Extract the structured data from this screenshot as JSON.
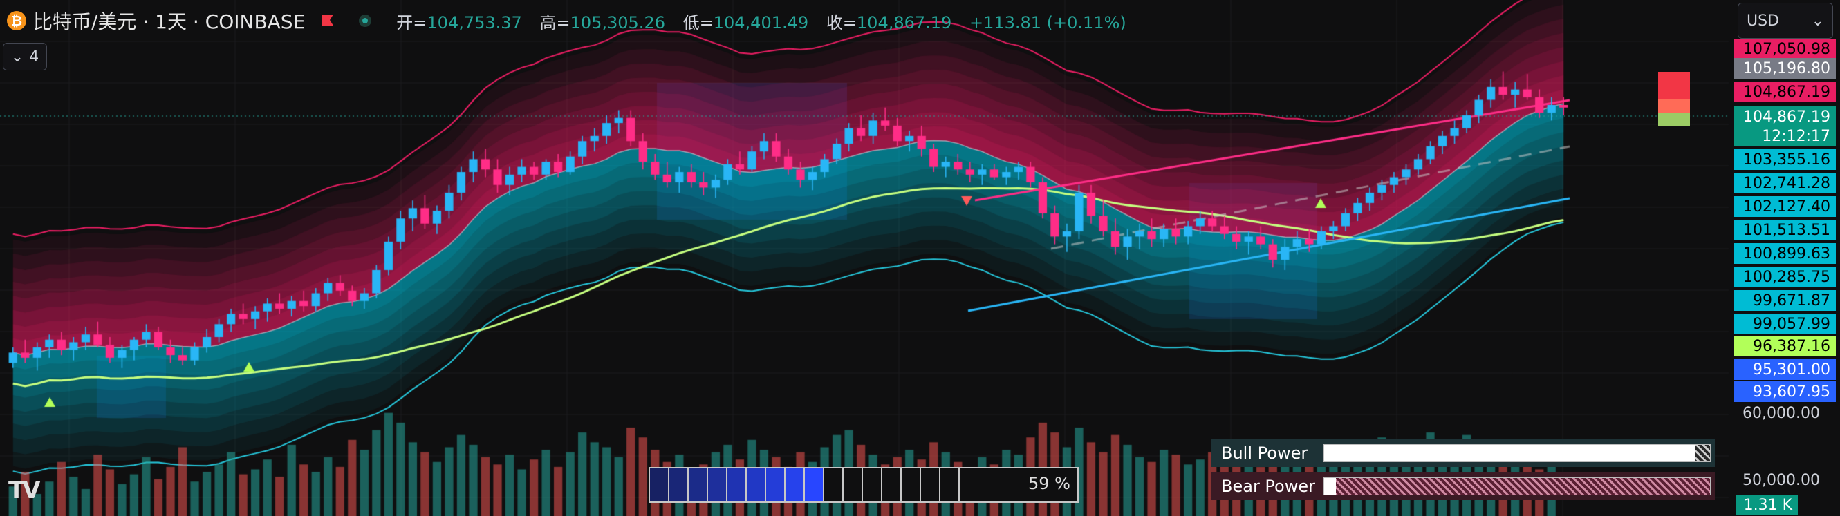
{
  "header": {
    "coin_icon": "bitcoin-icon",
    "symbol": "比特币/美元 · 1天 · COINBASE",
    "open_label": "开=",
    "open_value": "104,753.37",
    "high_label": "高=",
    "high_value": "105,305.26",
    "low_label": "低=",
    "low_value": "104,401.49",
    "close_label": "收=",
    "close_value": "104,867.19",
    "change": "+113.81 (+0.11%)"
  },
  "toolbar": {
    "collapse_label": "4",
    "currency": "USD"
  },
  "price_axis": {
    "labels": [
      {
        "text": "107,050.98",
        "bg": "#e91e63",
        "color": "#000000"
      },
      {
        "text": "105,196.80",
        "bg": "#787b86",
        "color": "#ffffff"
      },
      {
        "text": "104,867.19",
        "bg": "#e91e63",
        "color": "#000000"
      },
      {
        "text": "104,867.19",
        "bg": "#089981",
        "color": "#ffffff"
      },
      {
        "text": "12:12:17",
        "bg": "#089981",
        "color": "#ffffff"
      },
      {
        "text": "103,355.16",
        "bg": "#00bcd4",
        "color": "#000000"
      },
      {
        "text": "102,741.28",
        "bg": "#00bcd4",
        "color": "#000000"
      },
      {
        "text": "102,127.40",
        "bg": "#00bcd4",
        "color": "#000000"
      },
      {
        "text": "101,513.51",
        "bg": "#00bcd4",
        "color": "#000000"
      },
      {
        "text": "100,899.63",
        "bg": "#00bcd4",
        "color": "#000000"
      },
      {
        "text": "100,285.75",
        "bg": "#00bcd4",
        "color": "#000000"
      },
      {
        "text": "99,671.87",
        "bg": "#00bcd4",
        "color": "#000000"
      },
      {
        "text": "99,057.99",
        "bg": "#00bcd4",
        "color": "#000000"
      },
      {
        "text": "96,387.16",
        "bg": "#b2ff59",
        "color": "#000000"
      },
      {
        "text": "95,301.00",
        "bg": "#2962ff",
        "color": "#ffffff"
      },
      {
        "text": "93,607.95",
        "bg": "#2962ff",
        "color": "#ffffff"
      }
    ],
    "volume_labels": [
      "60,000.00",
      "50,000.00"
    ],
    "volume_current": "1.31 K"
  },
  "gauge": {
    "percent_text": "59 %",
    "filled_cells": 9,
    "total_cells": 16
  },
  "power": {
    "bull_label": "Bull Power",
    "bull_fraction": 0.96,
    "bear_label": "Bear Power",
    "bear_fraction": 0.03
  },
  "logo": "TV",
  "chart_data": {
    "type": "candlestick",
    "candles": [
      [
        95.0,
        95.6,
        94.8,
        95.4
      ],
      [
        95.4,
        95.9,
        95.0,
        95.2
      ],
      [
        95.2,
        95.8,
        94.7,
        95.6
      ],
      [
        95.6,
        96.1,
        95.2,
        95.9
      ],
      [
        95.9,
        96.2,
        95.3,
        95.5
      ],
      [
        95.5,
        96.0,
        95.1,
        95.8
      ],
      [
        95.8,
        96.4,
        95.5,
        96.1
      ],
      [
        96.1,
        96.6,
        95.6,
        95.7
      ],
      [
        95.7,
        96.0,
        95.0,
        95.2
      ],
      [
        95.2,
        95.7,
        94.8,
        95.5
      ],
      [
        95.5,
        96.0,
        95.1,
        95.9
      ],
      [
        95.9,
        96.5,
        95.6,
        96.2
      ],
      [
        96.2,
        96.4,
        95.5,
        95.6
      ],
      [
        95.6,
        95.9,
        95.0,
        95.3
      ],
      [
        95.3,
        95.6,
        94.9,
        95.1
      ],
      [
        95.1,
        95.8,
        94.9,
        95.6
      ],
      [
        95.6,
        96.3,
        95.4,
        96.0
      ],
      [
        96.0,
        96.7,
        95.8,
        96.5
      ],
      [
        96.5,
        97.1,
        96.2,
        96.9
      ],
      [
        96.9,
        97.3,
        96.5,
        96.7
      ],
      [
        96.7,
        97.2,
        96.3,
        97.0
      ],
      [
        97.0,
        97.5,
        96.6,
        97.3
      ],
      [
        97.3,
        97.7,
        96.9,
        97.1
      ],
      [
        97.1,
        97.6,
        96.8,
        97.4
      ],
      [
        97.4,
        97.8,
        97.0,
        97.2
      ],
      [
        97.2,
        97.9,
        97.0,
        97.7
      ],
      [
        97.7,
        98.3,
        97.4,
        98.1
      ],
      [
        98.1,
        98.4,
        97.6,
        97.8
      ],
      [
        97.8,
        98.0,
        97.2,
        97.4
      ],
      [
        97.4,
        97.9,
        97.1,
        97.7
      ],
      [
        97.7,
        98.8,
        97.5,
        98.6
      ],
      [
        98.6,
        99.9,
        98.4,
        99.7
      ],
      [
        99.7,
        100.9,
        99.4,
        100.6
      ],
      [
        100.6,
        101.3,
        100.1,
        101.0
      ],
      [
        101.0,
        101.5,
        100.2,
        100.4
      ],
      [
        100.4,
        101.1,
        100.0,
        100.9
      ],
      [
        100.9,
        101.9,
        100.6,
        101.6
      ],
      [
        101.6,
        102.6,
        101.3,
        102.4
      ],
      [
        102.4,
        103.2,
        102.0,
        102.9
      ],
      [
        102.9,
        103.3,
        102.2,
        102.5
      ],
      [
        102.5,
        102.9,
        101.6,
        101.9
      ],
      [
        101.9,
        102.6,
        101.5,
        102.3
      ],
      [
        102.3,
        102.9,
        102.0,
        102.6
      ],
      [
        102.6,
        102.8,
        102.1,
        102.3
      ],
      [
        102.3,
        102.9,
        102.1,
        102.8
      ],
      [
        102.8,
        103.1,
        102.2,
        102.4
      ],
      [
        102.4,
        103.2,
        102.3,
        103.0
      ],
      [
        103.0,
        103.8,
        102.7,
        103.6
      ],
      [
        103.6,
        104.1,
        103.2,
        103.8
      ],
      [
        103.8,
        104.6,
        103.5,
        104.3
      ],
      [
        104.3,
        104.8,
        103.9,
        104.5
      ],
      [
        104.5,
        104.8,
        103.4,
        103.6
      ],
      [
        103.6,
        103.9,
        102.5,
        102.8
      ],
      [
        102.8,
        103.1,
        102.1,
        102.3
      ],
      [
        102.3,
        102.8,
        101.8,
        102.0
      ],
      [
        102.0,
        102.6,
        101.6,
        102.4
      ],
      [
        102.4,
        102.7,
        101.8,
        102.0
      ],
      [
        102.0,
        102.4,
        101.5,
        101.8
      ],
      [
        101.8,
        102.3,
        101.4,
        102.1
      ],
      [
        102.1,
        102.9,
        101.9,
        102.7
      ],
      [
        102.7,
        103.2,
        102.3,
        102.5
      ],
      [
        102.5,
        103.4,
        102.4,
        103.2
      ],
      [
        103.2,
        103.9,
        102.9,
        103.6
      ],
      [
        103.6,
        103.9,
        102.8,
        103.0
      ],
      [
        103.0,
        103.3,
        102.3,
        102.5
      ],
      [
        102.5,
        102.8,
        101.8,
        102.1
      ],
      [
        102.1,
        102.6,
        101.7,
        102.4
      ],
      [
        102.4,
        103.1,
        102.2,
        102.9
      ],
      [
        102.9,
        103.7,
        102.7,
        103.5
      ],
      [
        103.5,
        104.3,
        103.2,
        104.1
      ],
      [
        104.1,
        104.6,
        103.6,
        103.8
      ],
      [
        103.8,
        104.7,
        103.5,
        104.4
      ],
      [
        104.4,
        104.9,
        104.0,
        104.2
      ],
      [
        104.2,
        104.5,
        103.4,
        103.6
      ],
      [
        103.6,
        104.0,
        103.2,
        103.8
      ],
      [
        103.8,
        104.2,
        103.0,
        103.3
      ],
      [
        103.3,
        103.5,
        102.4,
        102.6
      ],
      [
        102.6,
        103.0,
        102.2,
        102.8
      ],
      [
        102.8,
        103.1,
        102.3,
        102.5
      ],
      [
        102.5,
        102.8,
        102.0,
        102.3
      ],
      [
        102.3,
        102.7,
        101.9,
        102.5
      ],
      [
        102.5,
        102.7,
        102.1,
        102.2
      ],
      [
        102.2,
        102.6,
        101.9,
        102.4
      ],
      [
        102.4,
        102.8,
        102.1,
        102.6
      ],
      [
        102.6,
        102.8,
        101.8,
        102.0
      ],
      [
        102.0,
        102.2,
        100.6,
        100.8
      ],
      [
        100.8,
        101.1,
        99.6,
        99.9
      ],
      [
        99.9,
        100.4,
        99.3,
        100.1
      ],
      [
        100.1,
        101.9,
        99.8,
        101.6
      ],
      [
        101.6,
        101.9,
        100.4,
        100.7
      ],
      [
        100.7,
        101.3,
        99.9,
        100.1
      ],
      [
        100.1,
        100.6,
        99.2,
        99.5
      ],
      [
        99.5,
        100.2,
        99.0,
        99.9
      ],
      [
        99.9,
        100.4,
        99.4,
        100.1
      ],
      [
        100.1,
        100.6,
        99.5,
        99.8
      ],
      [
        99.8,
        100.4,
        99.5,
        100.2
      ],
      [
        100.2,
        100.6,
        99.6,
        99.9
      ],
      [
        99.9,
        100.5,
        99.6,
        100.3
      ],
      [
        100.3,
        100.9,
        100.0,
        100.6
      ],
      [
        100.6,
        100.9,
        100.1,
        100.3
      ],
      [
        100.3,
        100.7,
        99.8,
        100.0
      ],
      [
        100.0,
        100.3,
        99.4,
        99.7
      ],
      [
        99.7,
        100.1,
        99.2,
        99.9
      ],
      [
        99.9,
        100.3,
        99.4,
        99.6
      ],
      [
        99.6,
        99.8,
        98.7,
        99.0
      ],
      [
        99.0,
        99.8,
        98.6,
        99.5
      ],
      [
        99.5,
        100.1,
        99.2,
        99.8
      ],
      [
        99.8,
        100.2,
        99.3,
        99.6
      ],
      [
        99.6,
        100.3,
        99.4,
        100.1
      ],
      [
        100.1,
        100.5,
        99.8,
        100.3
      ],
      [
        100.3,
        101.0,
        100.1,
        100.8
      ],
      [
        100.8,
        101.4,
        100.5,
        101.2
      ],
      [
        101.2,
        101.8,
        100.9,
        101.6
      ],
      [
        101.6,
        102.1,
        101.3,
        101.9
      ],
      [
        101.9,
        102.4,
        101.6,
        102.2
      ],
      [
        102.2,
        102.7,
        101.9,
        102.5
      ],
      [
        102.5,
        103.1,
        102.3,
        102.9
      ],
      [
        102.9,
        103.6,
        102.7,
        103.4
      ],
      [
        103.4,
        104.0,
        103.1,
        103.8
      ],
      [
        103.8,
        104.4,
        103.5,
        104.1
      ],
      [
        104.1,
        104.8,
        103.9,
        104.6
      ],
      [
        104.6,
        105.4,
        104.3,
        105.2
      ],
      [
        105.2,
        106.0,
        104.9,
        105.7
      ],
      [
        105.7,
        106.3,
        105.2,
        105.4
      ],
      [
        105.4,
        105.9,
        104.9,
        105.6
      ],
      [
        105.6,
        106.2,
        105.2,
        105.3
      ],
      [
        105.3,
        105.6,
        104.5,
        104.7
      ],
      [
        104.7,
        105.3,
        104.4,
        105.0
      ],
      [
        105.0,
        105.3,
        104.6,
        104.9
      ]
    ],
    "volume": [
      12,
      18,
      9,
      14,
      22,
      16,
      11,
      25,
      19,
      13,
      17,
      24,
      15,
      20,
      28,
      14,
      18,
      21,
      26,
      17,
      19,
      23,
      16,
      29,
      21,
      18,
      24,
      20,
      31,
      27,
      35,
      42,
      38,
      30,
      26,
      22,
      28,
      33,
      29,
      24,
      21,
      25,
      19,
      23,
      27,
      20,
      26,
      34,
      30,
      28,
      24,
      36,
      32,
      27,
      22,
      25,
      19,
      21,
      26,
      29,
      23,
      31,
      27,
      24,
      20,
      26,
      22,
      28,
      33,
      35,
      29,
      25,
      21,
      24,
      27,
      23,
      30,
      26,
      22,
      19,
      24,
      21,
      27,
      25,
      32,
      38,
      34,
      28,
      36,
      30,
      26,
      33,
      29,
      24,
      22,
      27,
      25,
      21,
      23,
      26,
      22,
      28,
      24,
      20,
      31,
      27,
      23,
      25,
      21,
      26,
      24,
      29,
      27,
      32,
      28,
      25,
      30,
      34,
      31,
      27,
      33,
      29,
      24,
      22,
      26,
      21,
      19,
      24
    ],
    "price_range": [
      93.0,
      108.0
    ],
    "unit": "USD (thousands)"
  }
}
